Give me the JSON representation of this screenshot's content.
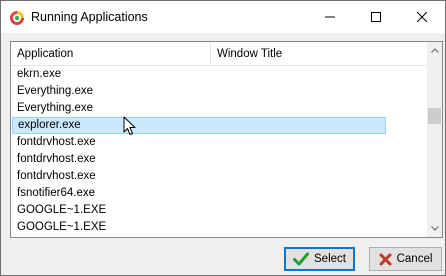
{
  "window": {
    "title": "Running Applications"
  },
  "titlebar_buttons": {
    "minimize": "minimize",
    "maximize": "maximize",
    "close": "close"
  },
  "list": {
    "columns": [
      "Application",
      "Window Title"
    ],
    "rows": [
      {
        "application": "ekrn.exe",
        "window_title": ""
      },
      {
        "application": "Everything.exe",
        "window_title": ""
      },
      {
        "application": "Everything.exe",
        "window_title": ""
      },
      {
        "application": "explorer.exe",
        "window_title": "",
        "selected": true
      },
      {
        "application": "fontdrvhost.exe",
        "window_title": ""
      },
      {
        "application": "fontdrvhost.exe",
        "window_title": ""
      },
      {
        "application": "fontdrvhost.exe",
        "window_title": ""
      },
      {
        "application": "fsnotifier64.exe",
        "window_title": ""
      },
      {
        "application": "GOOGLE~1.EXE",
        "window_title": ""
      },
      {
        "application": "GOOGLE~1.EXE",
        "window_title": ""
      }
    ]
  },
  "buttons": {
    "select": "Select",
    "cancel": "Cancel"
  },
  "colors": {
    "selection_fill": "#cce8ff",
    "selection_border": "#99d1ff",
    "default_button_border": "#0078d7",
    "select_check": "#1e9e2f",
    "cancel_x": "#c0392b"
  },
  "icons": {
    "app": "app-logo-icon",
    "select": "check-icon",
    "cancel": "x-icon"
  }
}
